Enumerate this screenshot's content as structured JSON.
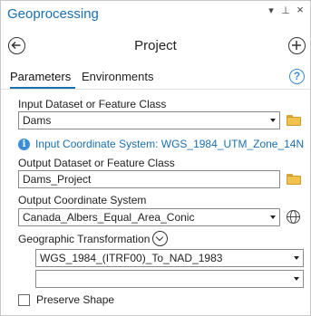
{
  "pane": {
    "title": "Geoprocessing",
    "controls": {
      "menu": "▾",
      "pin": "⊥",
      "close": "×"
    }
  },
  "tool": {
    "title": "Project",
    "back_icon": "back-arrow-icon",
    "add_icon": "plus-icon"
  },
  "tabs": [
    {
      "label": "Parameters",
      "active": true
    },
    {
      "label": "Environments",
      "active": false
    }
  ],
  "help_glyph": "?",
  "params": {
    "input_label": "Input Dataset or Feature Class",
    "input_value": "Dams",
    "input_coord_info": "Input Coordinate System: WGS_1984_UTM_Zone_14N",
    "output_label": "Output Dataset or Feature Class",
    "output_value": "Dams_Project",
    "out_cs_label": "Output Coordinate System",
    "out_cs_value": "Canada_Albers_Equal_Area_Conic",
    "geo_transform_label": "Geographic Transformation",
    "geo_transform_value": "WGS_1984_(ITRF00)_To_NAD_1983",
    "geo_transform_value2": "",
    "preserve_shape_label": "Preserve Shape",
    "preserve_shape_checked": false
  },
  "colors": {
    "accent": "#1a6fb0",
    "info": "#3a8dd6",
    "folder": "#f2c24e"
  }
}
